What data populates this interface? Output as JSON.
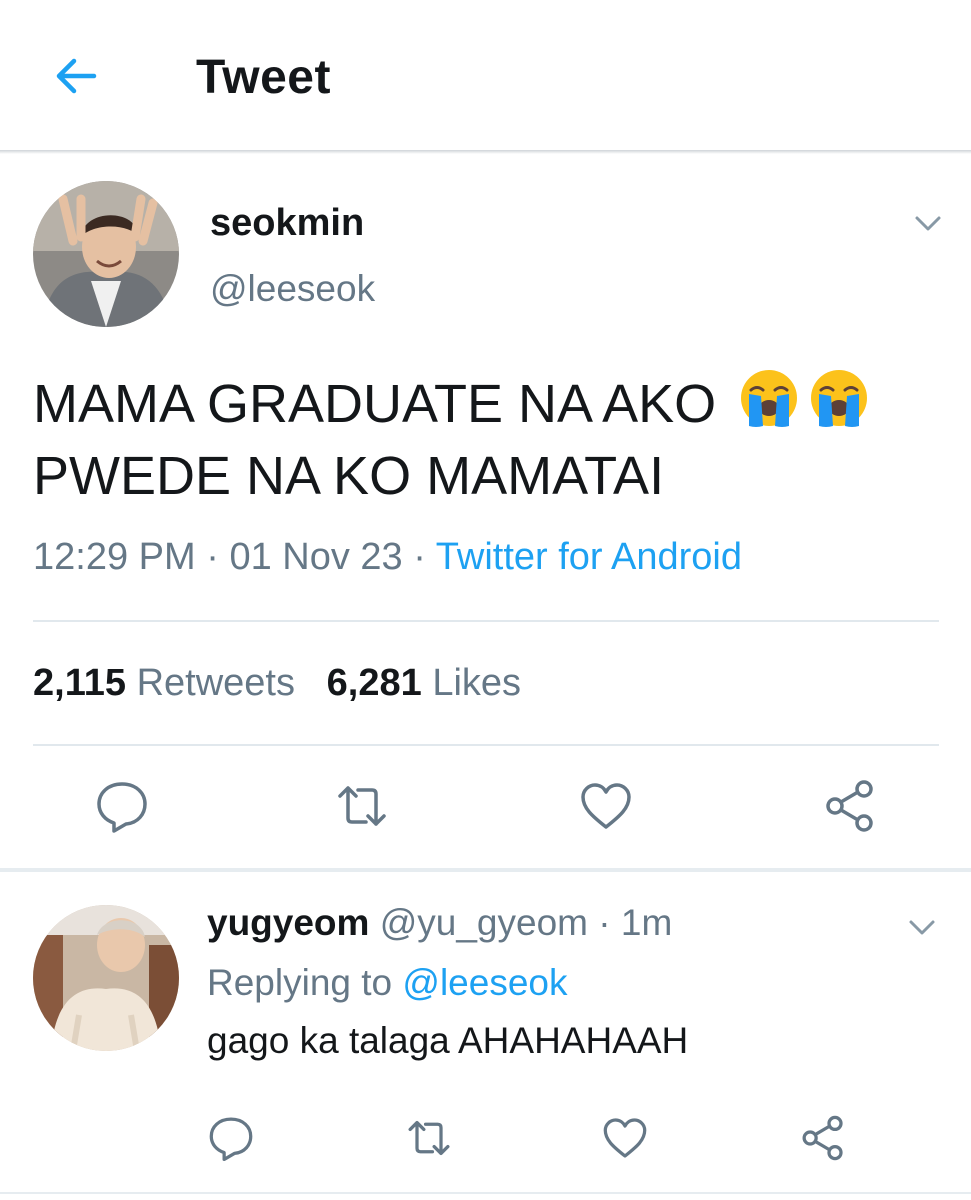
{
  "header": {
    "title": "Tweet",
    "back_icon": "back-arrow-icon"
  },
  "main_tweet": {
    "display_name": "seokmin",
    "handle": "@leeseok",
    "text_line1": "MAMA GRADUATE NA AKO",
    "text_line2": "PWEDE NA KO MAMATAI",
    "emojis": [
      "loudly-crying-face-emoji",
      "loudly-crying-face-emoji"
    ],
    "time": "12:29 PM",
    "date": "01 Nov 23",
    "separator": "·",
    "source": "Twitter for Android",
    "retweet_count": "2,115",
    "retweet_label": "Retweets",
    "like_count": "6,281",
    "like_label": "Likes",
    "actions": [
      "reply-icon",
      "retweet-icon",
      "like-icon",
      "share-icon"
    ]
  },
  "reply_tweet": {
    "display_name": "yugyeom",
    "handle": "@yu_gyeom",
    "separator": "·",
    "time_ago": "1m",
    "replying_prefix": "Replying to",
    "replying_to": "@leeseok",
    "text": "gago ka talaga AHAHAHAAH",
    "actions": [
      "reply-icon",
      "retweet-icon",
      "like-icon",
      "share-icon"
    ]
  },
  "colors": {
    "accent": "#1da1f2",
    "secondary_text": "#657786",
    "primary_text": "#14171a",
    "divider": "#e1e8ed"
  }
}
